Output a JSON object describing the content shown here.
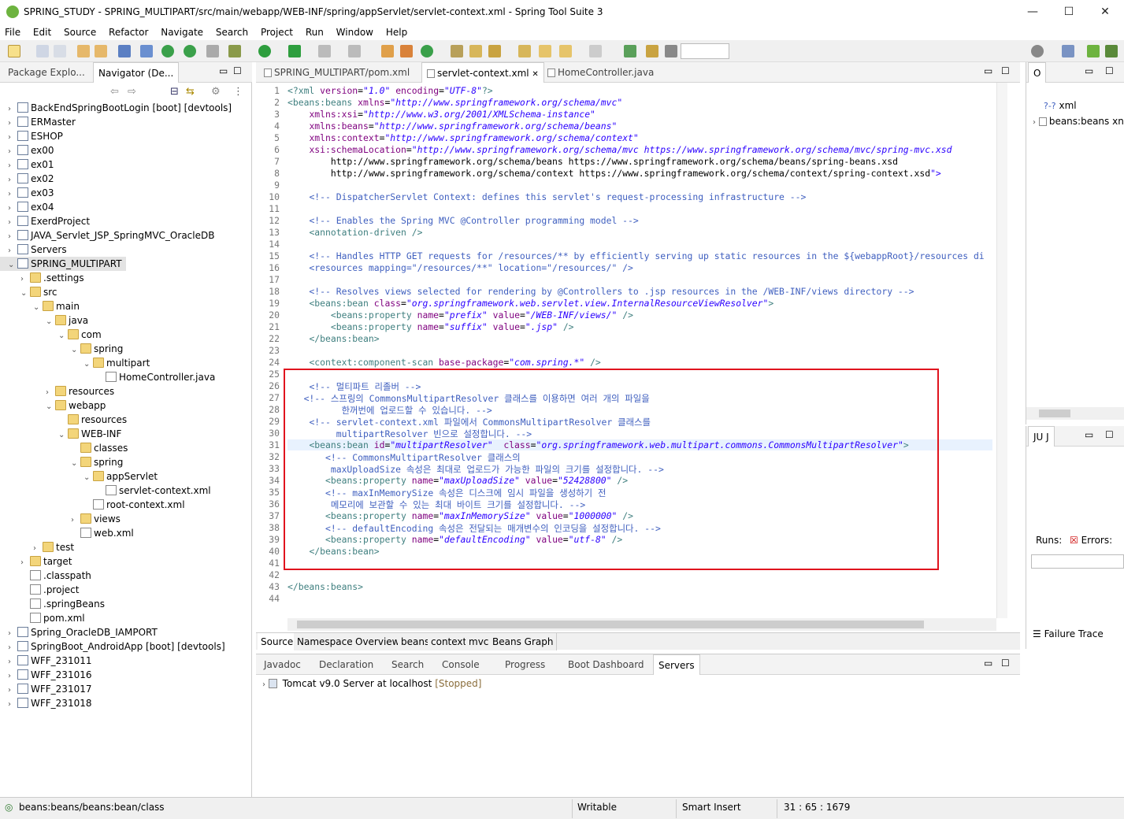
{
  "window": {
    "title": "SPRING_STUDY - SPRING_MULTIPART/src/main/webapp/WEB-INF/spring/appServlet/servlet-context.xml - Spring Tool Suite 3",
    "minimize": "—",
    "maximize": "☐",
    "close": "✕"
  },
  "menu": [
    "File",
    "Edit",
    "Source",
    "Refactor",
    "Navigate",
    "Search",
    "Project",
    "Run",
    "Window",
    "Help"
  ],
  "left_panel": {
    "tabs": [
      "Package Explo...",
      "Navigator (De..."
    ],
    "tree": [
      {
        "d": 0,
        "a": "›",
        "i": "proj",
        "t": "BackEndSpringBootLogin [boot] [devtools]"
      },
      {
        "d": 0,
        "a": "›",
        "i": "proj",
        "t": "ERMaster"
      },
      {
        "d": 0,
        "a": "›",
        "i": "proj",
        "t": "ESHOP"
      },
      {
        "d": 0,
        "a": "›",
        "i": "proj",
        "t": "ex00"
      },
      {
        "d": 0,
        "a": "›",
        "i": "proj",
        "t": "ex01"
      },
      {
        "d": 0,
        "a": "›",
        "i": "proj",
        "t": "ex02"
      },
      {
        "d": 0,
        "a": "›",
        "i": "proj",
        "t": "ex03"
      },
      {
        "d": 0,
        "a": "›",
        "i": "proj",
        "t": "ex04"
      },
      {
        "d": 0,
        "a": "›",
        "i": "proj",
        "t": "ExerdProject"
      },
      {
        "d": 0,
        "a": "›",
        "i": "proj",
        "t": "JAVA_Servlet_JSP_SpringMVC_OracleDB"
      },
      {
        "d": 0,
        "a": "›",
        "i": "proj",
        "t": "Servers"
      },
      {
        "d": 0,
        "a": "⌄",
        "i": "proj",
        "t": "SPRING_MULTIPART",
        "sel": true
      },
      {
        "d": 1,
        "a": "›",
        "i": "fold",
        "t": ".settings"
      },
      {
        "d": 1,
        "a": "⌄",
        "i": "fold",
        "t": "src"
      },
      {
        "d": 2,
        "a": "⌄",
        "i": "fold",
        "t": "main"
      },
      {
        "d": 3,
        "a": "⌄",
        "i": "fold",
        "t": "java"
      },
      {
        "d": 4,
        "a": "⌄",
        "i": "fold",
        "t": "com"
      },
      {
        "d": 5,
        "a": "⌄",
        "i": "fold",
        "t": "spring"
      },
      {
        "d": 6,
        "a": "⌄",
        "i": "fold",
        "t": "multipart"
      },
      {
        "d": 7,
        "a": "",
        "i": "file",
        "t": "HomeController.java"
      },
      {
        "d": 3,
        "a": "›",
        "i": "fold",
        "t": "resources"
      },
      {
        "d": 3,
        "a": "⌄",
        "i": "fold",
        "t": "webapp"
      },
      {
        "d": 4,
        "a": "",
        "i": "fold",
        "t": "resources"
      },
      {
        "d": 4,
        "a": "⌄",
        "i": "fold",
        "t": "WEB-INF"
      },
      {
        "d": 5,
        "a": "",
        "i": "fold",
        "t": "classes"
      },
      {
        "d": 5,
        "a": "⌄",
        "i": "fold",
        "t": "spring"
      },
      {
        "d": 6,
        "a": "⌄",
        "i": "fold",
        "t": "appServlet"
      },
      {
        "d": 7,
        "a": "",
        "i": "file",
        "t": "servlet-context.xml"
      },
      {
        "d": 6,
        "a": "",
        "i": "file",
        "t": "root-context.xml"
      },
      {
        "d": 5,
        "a": "›",
        "i": "fold",
        "t": "views"
      },
      {
        "d": 5,
        "a": "",
        "i": "file",
        "t": "web.xml"
      },
      {
        "d": 2,
        "a": "›",
        "i": "fold",
        "t": "test"
      },
      {
        "d": 1,
        "a": "›",
        "i": "fold",
        "t": "target"
      },
      {
        "d": 1,
        "a": "",
        "i": "file",
        "t": ".classpath"
      },
      {
        "d": 1,
        "a": "",
        "i": "file",
        "t": ".project"
      },
      {
        "d": 1,
        "a": "",
        "i": "file",
        "t": ".springBeans"
      },
      {
        "d": 1,
        "a": "",
        "i": "file",
        "t": "pom.xml"
      },
      {
        "d": 0,
        "a": "›",
        "i": "proj",
        "t": "Spring_OracleDB_IAMPORT"
      },
      {
        "d": 0,
        "a": "›",
        "i": "proj",
        "t": "SpringBoot_AndroidApp [boot] [devtools]"
      },
      {
        "d": 0,
        "a": "›",
        "i": "proj",
        "t": "WFF_231011"
      },
      {
        "d": 0,
        "a": "›",
        "i": "proj",
        "t": "WFF_231016"
      },
      {
        "d": 0,
        "a": "›",
        "i": "proj",
        "t": "WFF_231017"
      },
      {
        "d": 0,
        "a": "›",
        "i": "proj",
        "t": "WFF_231018"
      }
    ]
  },
  "editor": {
    "tabs": [
      "SPRING_MULTIPART/pom.xml",
      "servlet-context.xml",
      "HomeController.java"
    ],
    "lines": [
      "<?xml version=\"1.0\" encoding=\"UTF-8\"?>",
      "<beans:beans xmlns=\"http://www.springframework.org/schema/mvc\"",
      "    xmlns:xsi=\"http://www.w3.org/2001/XMLSchema-instance\"",
      "    xmlns:beans=\"http://www.springframework.org/schema/beans\"",
      "    xmlns:context=\"http://www.springframework.org/schema/context\"",
      "    xsi:schemaLocation=\"http://www.springframework.org/schema/mvc https://www.springframework.org/schema/mvc/spring-mvc.xsd",
      "        http://www.springframework.org/schema/beans https://www.springframework.org/schema/beans/spring-beans.xsd",
      "        http://www.springframework.org/schema/context https://www.springframework.org/schema/context/spring-context.xsd\">",
      "",
      "    <!-- DispatcherServlet Context: defines this servlet's request-processing infrastructure -->",
      "",
      "    <!-- Enables the Spring MVC @Controller programming model -->",
      "    <annotation-driven />",
      "",
      "    <!-- Handles HTTP GET requests for /resources/** by efficiently serving up static resources in the ${webappRoot}/resources di",
      "    <resources mapping=\"/resources/**\" location=\"/resources/\" />",
      "",
      "    <!-- Resolves views selected for rendering by @Controllers to .jsp resources in the /WEB-INF/views directory -->",
      "    <beans:bean class=\"org.springframework.web.servlet.view.InternalResourceViewResolver\">",
      "        <beans:property name=\"prefix\" value=\"/WEB-INF/views/\" />",
      "        <beans:property name=\"suffix\" value=\".jsp\" />",
      "    </beans:bean>",
      "",
      "    <context:component-scan base-package=\"com.spring.*\" />",
      "",
      "    <!-- 멀티파트 리졸버 -->",
      "   <!-- 스프링의 CommonsMultipartResolver 클래스를 이용하면 여러 개의 파일을",
      "          한꺼번에 업로드할 수 있습니다. -->",
      "    <!-- servlet-context.xml 파일에서 CommonsMultipartResolver 클래스를",
      "         multipartResolver 빈으로 설정합니다. -->",
      "    <beans:bean id=\"multipartResolver\"  class=\"org.springframework.web.multipart.commons.CommonsMultipartResolver\">",
      "       <!-- CommonsMultipartResolver 클래스의",
      "        maxUploadSize 속성은 최대로 업로드가 가능한 파일의 크기를 설정합니다. -->",
      "       <beans:property name=\"maxUploadSize\" value=\"52428800\" />",
      "       <!-- maxInMemorySize 속성은 디스크에 임시 파일을 생성하기 전",
      "        메모리에 보관할 수 있는 최대 바이트 크기를 설정합니다. -->",
      "       <beans:property name=\"maxInMemorySize\" value=\"1000000\" />",
      "       <!-- defaultEncoding 속성은 전달되는 매개변수의 인코딩을 설정합니다. -->",
      "       <beans:property name=\"defaultEncoding\" value=\"utf-8\" />",
      "    </beans:bean>",
      "",
      "",
      "</beans:beans>",
      ""
    ],
    "bottom_tabs": [
      "Source",
      "Namespaces",
      "Overview",
      "beans",
      "context",
      "mvc",
      "Beans Graph"
    ]
  },
  "outline": {
    "tab": "O",
    "items": [
      "xml",
      "beans:beans xn"
    ]
  },
  "junit": {
    "tab": "JU J",
    "runs": "Runs:",
    "errors": "Errors:",
    "failure_trace": "Failure Trace"
  },
  "bottom_panel": {
    "tabs": [
      "Javadoc",
      "Declaration",
      "Search",
      "Console",
      "Progress",
      "Boot Dashboard",
      "Servers"
    ],
    "server": "Tomcat v9.0 Server at localhost",
    "server_state": "[Stopped]"
  },
  "status": {
    "path": "beans:beans/beans:bean/class",
    "writable": "Writable",
    "insert": "Smart Insert",
    "pos": "31 : 65 : 1679"
  }
}
